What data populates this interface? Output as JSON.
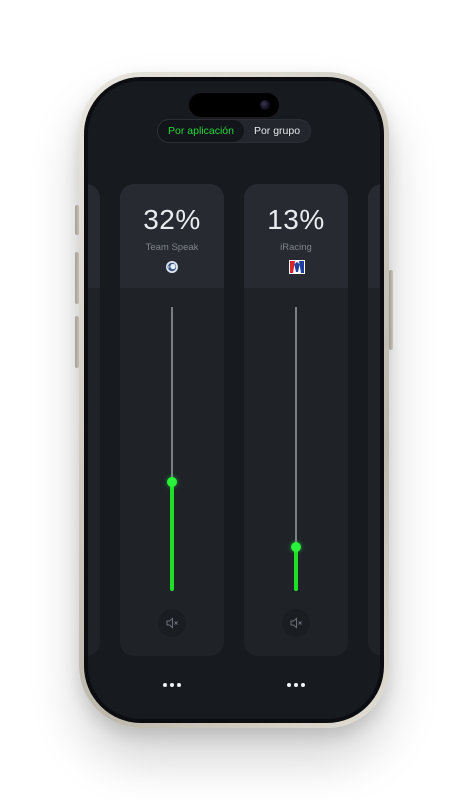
{
  "segmented": {
    "options": [
      "Por aplicación",
      "Por grupo"
    ],
    "selected": "Por aplicación"
  },
  "channels": [
    {
      "percent_label": "32%",
      "name": "Team Speak",
      "icon": "teamspeak-icon",
      "level": 0.32,
      "muted": false
    },
    {
      "percent_label": "13%",
      "name": "iRacing",
      "icon": "iracing-icon",
      "level": 0.13,
      "muted": false
    }
  ],
  "colors": {
    "accent": "#26d83a",
    "background": "#171a1f",
    "card": "#1f2328",
    "card_header": "#272b31"
  },
  "icons": {
    "mute": "speaker-mute-icon",
    "more": "more-dots-icon"
  }
}
